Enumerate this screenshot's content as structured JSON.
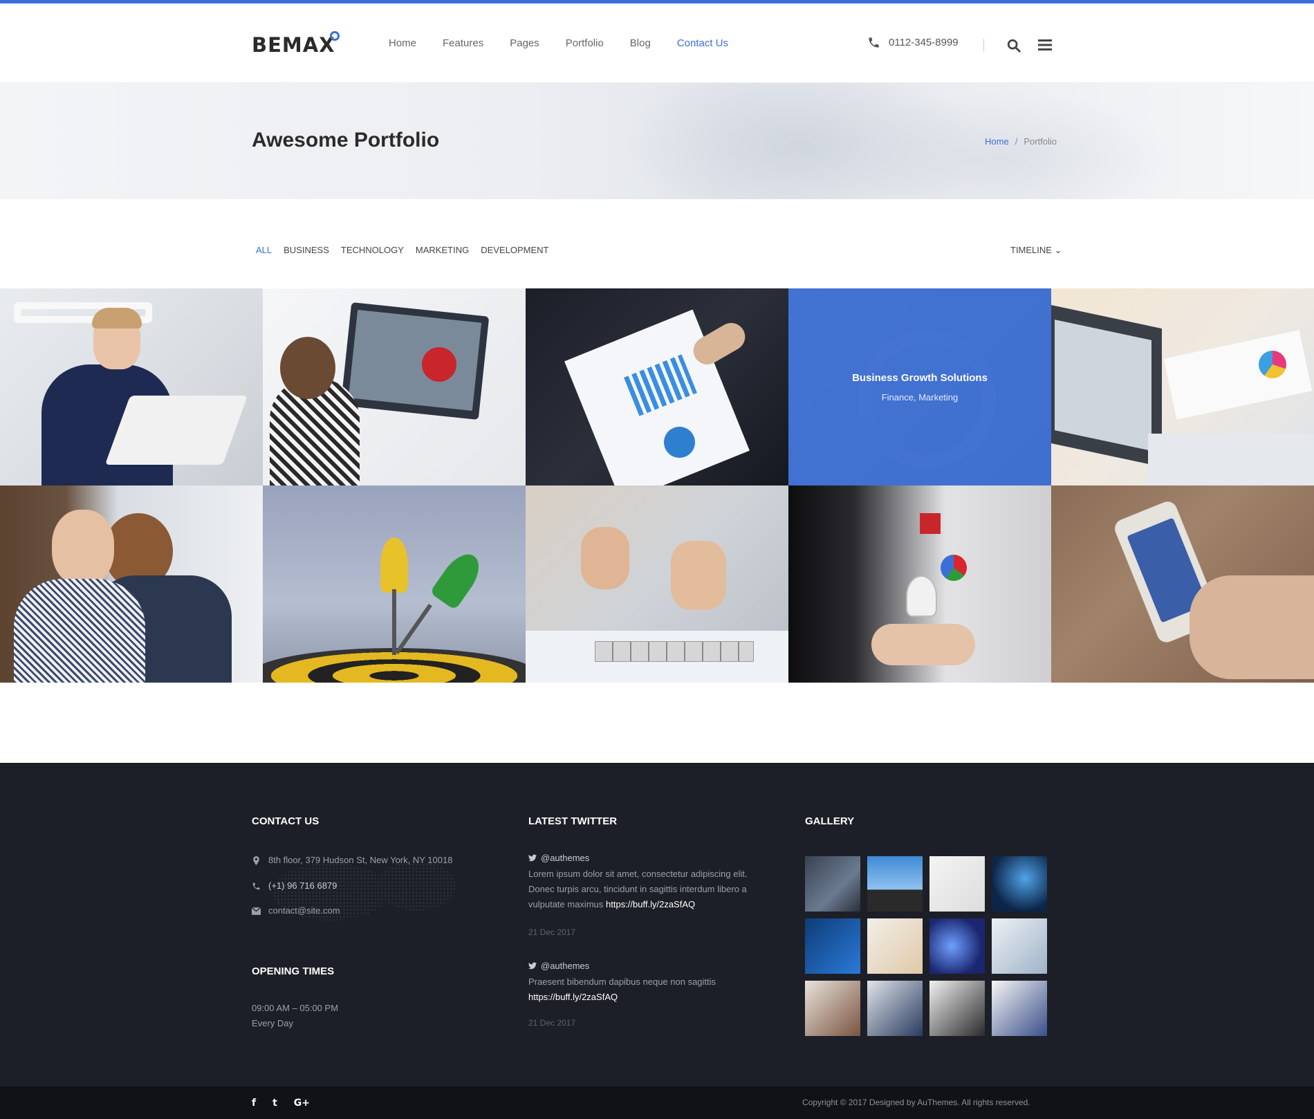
{
  "header": {
    "logo": "BEMAX",
    "nav": [
      "Home",
      "Features",
      "Pages",
      "Portfolio",
      "Blog",
      "Contact Us"
    ],
    "active_nav": "Contact Us",
    "phone": "0112-345-8999",
    "accent_color": "#3b6fd8"
  },
  "page": {
    "title": "Awesome Portfolio",
    "breadcrumb": {
      "home": "Home",
      "separator": "/",
      "current": "Portfolio"
    }
  },
  "filters": {
    "items": [
      "ALL",
      "BUSINESS",
      "TECHNOLOGY",
      "MARKETING",
      "DEVELOPMENT"
    ],
    "active": "ALL",
    "sort_label": "TIMELINE"
  },
  "portfolio": {
    "hover_tile": {
      "title": "Business Growth Solutions",
      "categories": "Finance, Marketing"
    },
    "tiles": [
      "man-with-laptop-photo",
      "woman-at-monitor-photo",
      "report-charts-photo",
      "hovered-tile",
      "laptop-charts-photo",
      "smiling-woman-photo",
      "darts-target-photo",
      "success-blocks-photo",
      "idea-hand-photo",
      "smartphone-photo"
    ]
  },
  "footer": {
    "contact": {
      "title": "CONTACT US",
      "address": "8th floor, 379 Hudson St, New York, NY 10018",
      "phone": "(+1) 96 716 6879",
      "email": "contact@site.com"
    },
    "opening": {
      "title": "OPENING TIMES",
      "hours": "09:00 AM – 05:00 PM",
      "days": "Every Day"
    },
    "twitter": {
      "title": "LATEST TWITTER",
      "tweets": [
        {
          "handle": "@authemes",
          "text": "Lorem ipsum dolor sit amet, consectetur adipiscing elit. Donec turpis arcu, tincidunt in sagittis interdum libero a vulputate maximus",
          "link": "https://buff.ly/2zaSfAQ",
          "date": "21 Dec 2017"
        },
        {
          "handle": "@authemes",
          "text": "Praesent bibendum dapibus neque non sagittis",
          "link": "https://buff.ly/2zaSfAQ",
          "date": "21 Dec 2017"
        }
      ]
    },
    "gallery": {
      "title": "GALLERY"
    },
    "social": [
      "f",
      "t",
      "G+"
    ],
    "copyright": "Copyright © 2017 Designed by AuThemes. All rights reserved."
  }
}
